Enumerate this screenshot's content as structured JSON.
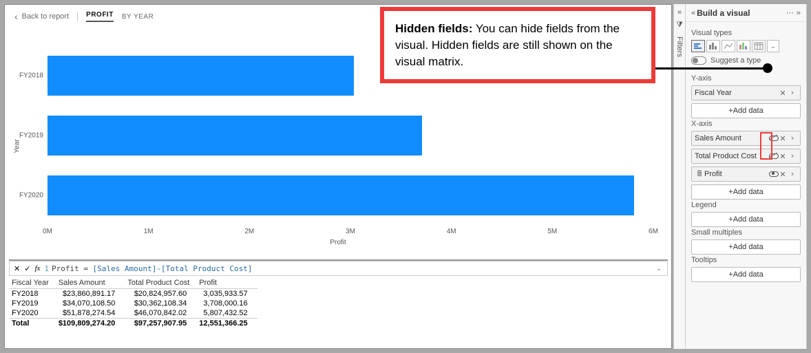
{
  "header": {
    "back_label": "Back to report",
    "tabs": [
      {
        "label": "PROFIT",
        "active": true
      },
      {
        "label": "BY YEAR",
        "active": false
      }
    ]
  },
  "chart_data": {
    "type": "bar",
    "orientation": "horizontal",
    "categories": [
      "FY2018",
      "FY2019",
      "FY2020"
    ],
    "values": [
      3035933.57,
      3708000.16,
      5807432.52
    ],
    "title": "",
    "xlabel": "Profit",
    "ylabel": "Year",
    "xlim": [
      0,
      6000000
    ],
    "ticks": [
      "0M",
      "1M",
      "2M",
      "3M",
      "4M",
      "5M",
      "6M"
    ],
    "bar_color": "#118dff"
  },
  "formula": {
    "line_no": "1",
    "text_plain": "Profit = [Sales Amount]-[Total Product Cost]",
    "measure": "Profit",
    "expr": "[Sales Amount]-[Total Product Cost]"
  },
  "matrix": {
    "columns": [
      "Fiscal Year",
      "Sales Amount",
      "Total Product Cost",
      "Profit"
    ],
    "rows": [
      {
        "fy": "FY2018",
        "sales": "$23,860,891.17",
        "cost": "$20,824,957.60",
        "profit": "3,035,933.57"
      },
      {
        "fy": "FY2019",
        "sales": "$34,070,108.50",
        "cost": "$30,362,108.34",
        "profit": "3,708,000.16"
      },
      {
        "fy": "FY2020",
        "sales": "$51,878,274.54",
        "cost": "$46,070,842.02",
        "profit": "5,807,432.52"
      }
    ],
    "total": {
      "fy": "Total",
      "sales": "$109,809,274.20",
      "cost": "$97,257,907.95",
      "profit": "12,551,366.25"
    }
  },
  "callout": {
    "title": "Hidden fields:",
    "body": "You can hide fields from the visual. Hidden fields are still shown on the visual matrix."
  },
  "filters_rail": {
    "label": "Filters"
  },
  "build": {
    "title": "Build a visual",
    "visual_types_label": "Visual types",
    "suggest_label": "Suggest a type",
    "add_data_label": "+Add data",
    "wells": {
      "yaxis": {
        "label": "Y-axis",
        "fields": [
          {
            "name": "Fiscal Year",
            "hidden": false,
            "measure": false
          }
        ]
      },
      "xaxis": {
        "label": "X-axis",
        "fields": [
          {
            "name": "Sales Amount",
            "hidden": true,
            "measure": false
          },
          {
            "name": "Total Product Cost",
            "hidden": true,
            "measure": false
          },
          {
            "name": "Profit",
            "hidden": false,
            "measure": true
          }
        ]
      },
      "legend": {
        "label": "Legend",
        "fields": []
      },
      "small_multiples": {
        "label": "Small multiples",
        "fields": []
      },
      "tooltips": {
        "label": "Tooltips",
        "fields": []
      }
    }
  }
}
